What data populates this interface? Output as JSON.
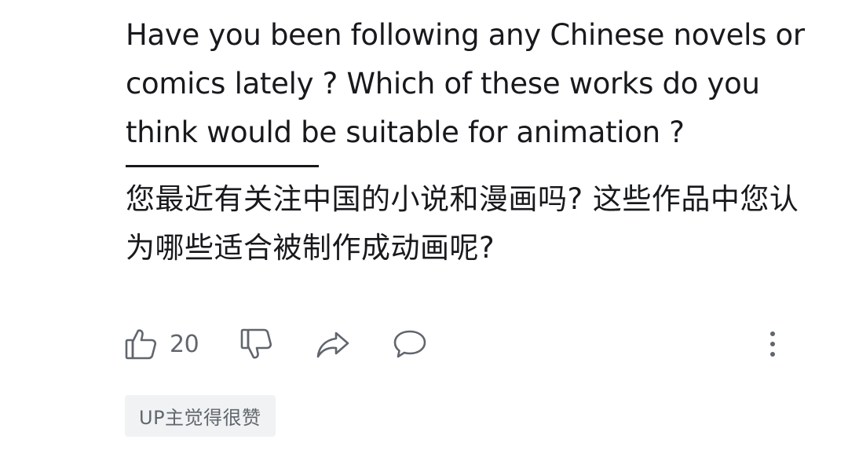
{
  "comment": {
    "text_en": "Have you been following any Chinese novels or comics lately ? Which of these works do you think would be suitable for animation ?",
    "text_zh": "您最近有关注中国的小说和漫画吗? 这些作品中您认为哪些适合被制作成动画呢?"
  },
  "actions": {
    "like_count": "20",
    "icons": {
      "like": "thumbs-up-icon",
      "dislike": "thumbs-down-icon",
      "share": "share-arrow-icon",
      "reply": "comment-bubble-icon",
      "more": "more-vertical-icon"
    },
    "icon_color": "#61666d"
  },
  "badge": {
    "label": "UP主觉得很赞"
  }
}
